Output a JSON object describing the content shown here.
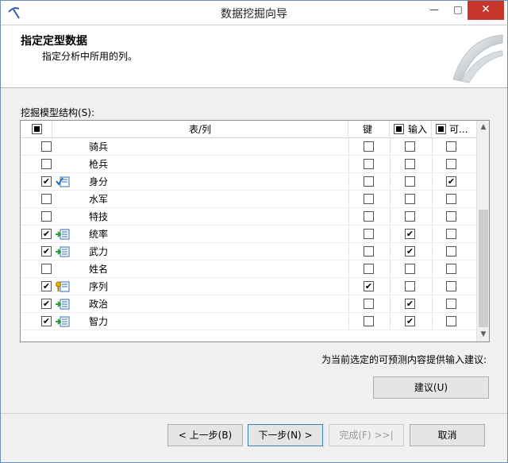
{
  "window": {
    "title": "数据挖掘向导",
    "minimize": "—",
    "maximize": "□",
    "close": "✕"
  },
  "header": {
    "title": "指定定型数据",
    "subtitle": "指定分析中所用的列。"
  },
  "grid": {
    "label": "挖掘模型结构(S):",
    "columns": {
      "table_col": "表/列",
      "key": "键",
      "input": "输入",
      "predict": "可..."
    },
    "rows": [
      {
        "name": "骑兵",
        "include": false,
        "icon": "none",
        "key": false,
        "input": false,
        "predict": false
      },
      {
        "name": "枪兵",
        "include": false,
        "icon": "none",
        "key": false,
        "input": false,
        "predict": false
      },
      {
        "name": "身分",
        "include": true,
        "icon": "predict-column-icon",
        "key": false,
        "input": false,
        "predict": true
      },
      {
        "name": "水军",
        "include": false,
        "icon": "none",
        "key": false,
        "input": false,
        "predict": false
      },
      {
        "name": "特技",
        "include": false,
        "icon": "none",
        "key": false,
        "input": false,
        "predict": false
      },
      {
        "name": "统率",
        "include": true,
        "icon": "input-column-icon",
        "key": false,
        "input": true,
        "predict": false
      },
      {
        "name": "武力",
        "include": true,
        "icon": "input-column-icon",
        "key": false,
        "input": true,
        "predict": false
      },
      {
        "name": "姓名",
        "include": false,
        "icon": "none",
        "key": false,
        "input": false,
        "predict": false
      },
      {
        "name": "序列",
        "include": true,
        "icon": "key-column-icon",
        "key": true,
        "input": false,
        "predict": false
      },
      {
        "name": "政治",
        "include": true,
        "icon": "input-column-icon",
        "key": false,
        "input": true,
        "predict": false
      },
      {
        "name": "智力",
        "include": true,
        "icon": "input-column-icon",
        "key": false,
        "input": true,
        "predict": false
      }
    ]
  },
  "suggest": {
    "text": "为当前选定的可预测内容提供输入建议:",
    "button": "建议(U)"
  },
  "footer": {
    "back": "< 上一步(B)",
    "next": "下一步(N) >",
    "finish": "完成(F) >>|",
    "cancel": "取消"
  }
}
